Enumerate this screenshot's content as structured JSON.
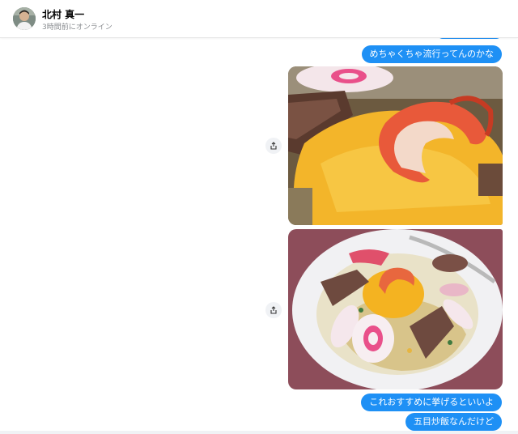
{
  "chat": {
    "contact_name": "北村 真一",
    "contact_status": "3時間前にオンライン"
  },
  "messages": [
    {
      "type": "text",
      "text": "めちゃくちゃ流行ってんのかな"
    },
    {
      "type": "image",
      "subject": "omelette-shrimp-closeup"
    },
    {
      "type": "image",
      "subject": "fried-rice-plate"
    },
    {
      "type": "text",
      "text": "これおすすめに挙げるといいよ"
    },
    {
      "type": "text",
      "text": "五目炒飯なんだけど"
    }
  ],
  "colors": {
    "bubble": "#1e90f5",
    "bubble_text": "#ffffff",
    "share_bg": "#f0f2f5"
  },
  "icons": {
    "share": "share-icon",
    "avatar": "avatar"
  }
}
